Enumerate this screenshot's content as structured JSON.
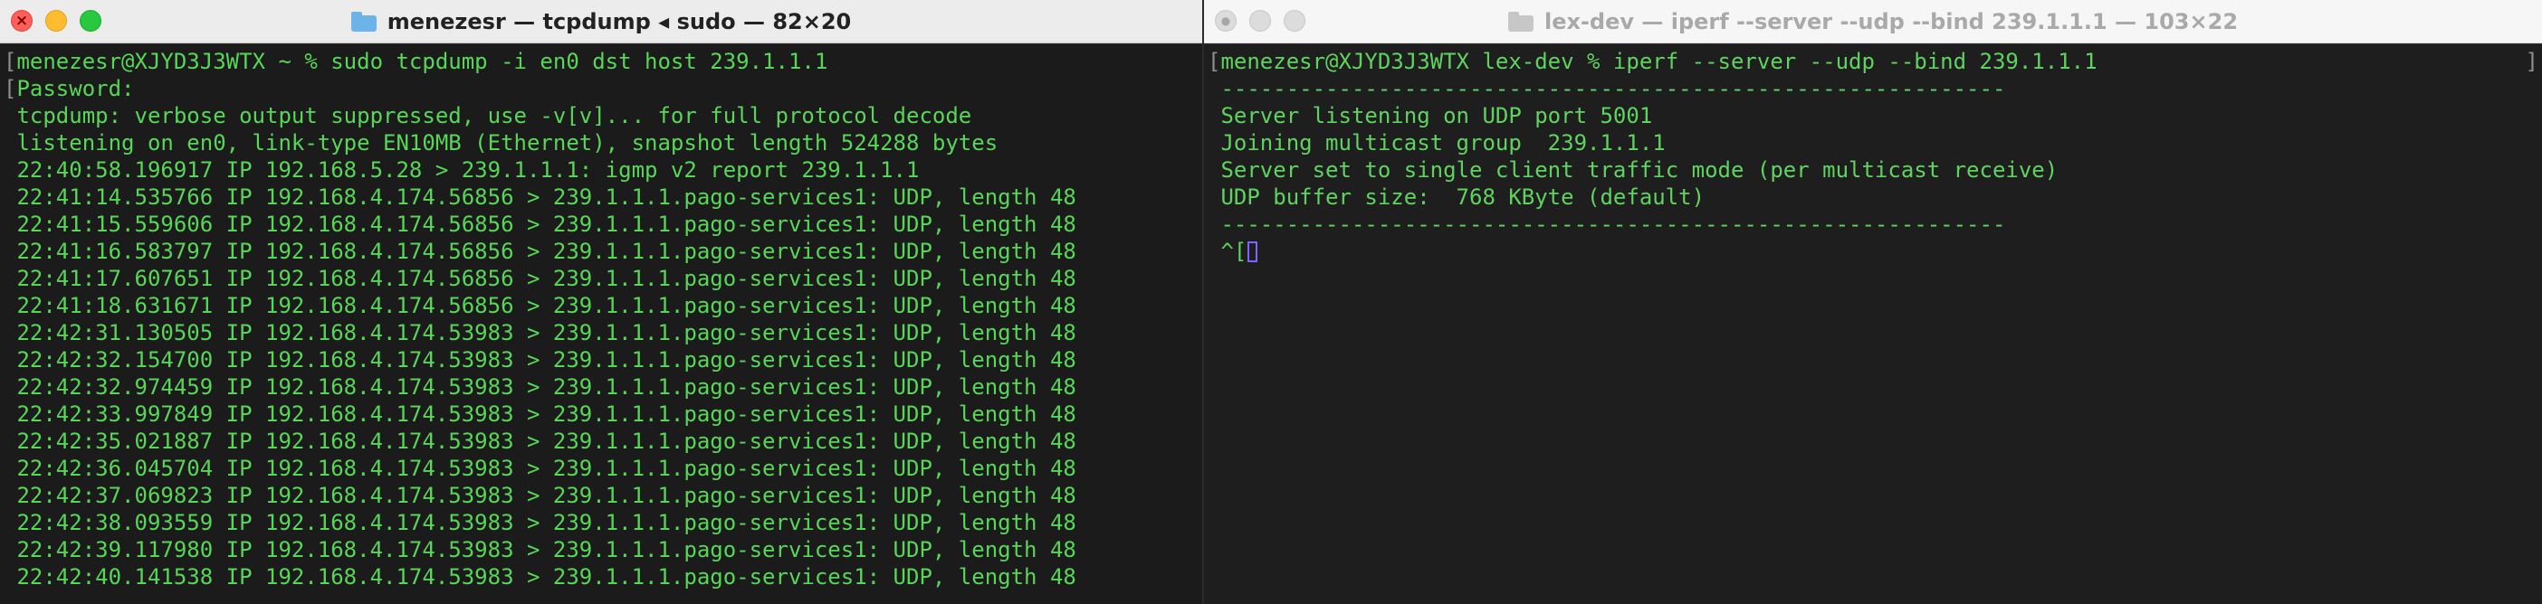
{
  "left_window": {
    "title": "menezesr — tcpdump ◂ sudo — 82×20",
    "lines": [
      "menezesr@XJYD3J3WTX ~ % sudo tcpdump -i en0 dst host 239.1.1.1",
      "Password:",
      "tcpdump: verbose output suppressed, use -v[v]... for full protocol decode",
      "listening on en0, link-type EN10MB (Ethernet), snapshot length 524288 bytes",
      "22:40:58.196917 IP 192.168.5.28 > 239.1.1.1: igmp v2 report 239.1.1.1",
      "22:41:14.535766 IP 192.168.4.174.56856 > 239.1.1.1.pago-services1: UDP, length 48",
      "22:41:15.559606 IP 192.168.4.174.56856 > 239.1.1.1.pago-services1: UDP, length 48",
      "22:41:16.583797 IP 192.168.4.174.56856 > 239.1.1.1.pago-services1: UDP, length 48",
      "22:41:17.607651 IP 192.168.4.174.56856 > 239.1.1.1.pago-services1: UDP, length 48",
      "22:41:18.631671 IP 192.168.4.174.56856 > 239.1.1.1.pago-services1: UDP, length 48",
      "22:42:31.130505 IP 192.168.4.174.53983 > 239.1.1.1.pago-services1: UDP, length 48",
      "22:42:32.154700 IP 192.168.4.174.53983 > 239.1.1.1.pago-services1: UDP, length 48",
      "22:42:32.974459 IP 192.168.4.174.53983 > 239.1.1.1.pago-services1: UDP, length 48",
      "22:42:33.997849 IP 192.168.4.174.53983 > 239.1.1.1.pago-services1: UDP, length 48",
      "22:42:35.021887 IP 192.168.4.174.53983 > 239.1.1.1.pago-services1: UDP, length 48",
      "22:42:36.045704 IP 192.168.4.174.53983 > 239.1.1.1.pago-services1: UDP, length 48",
      "22:42:37.069823 IP 192.168.4.174.53983 > 239.1.1.1.pago-services1: UDP, length 48",
      "22:42:38.093559 IP 192.168.4.174.53983 > 239.1.1.1.pago-services1: UDP, length 48",
      "22:42:39.117980 IP 192.168.4.174.53983 > 239.1.1.1.pago-services1: UDP, length 48",
      "22:42:40.141538 IP 192.168.4.174.53983 > 239.1.1.1.pago-services1: UDP, length 48"
    ]
  },
  "right_window": {
    "title": "lex-dev — iperf --server --udp --bind 239.1.1.1 — 103×22",
    "lines": [
      "menezesr@XJYD3J3WTX lex-dev % iperf --server --udp --bind 239.1.1.1",
      "------------------------------------------------------------",
      "Server listening on UDP port 5001",
      "Joining multicast group  239.1.1.1",
      "Server set to single client traffic mode (per multicast receive)",
      "UDP buffer size:  768 KByte (default)",
      "------------------------------------------------------------",
      "^["
    ]
  },
  "icons": {
    "close": "close-icon",
    "minimize": "minimize-icon",
    "zoom": "zoom-icon",
    "folder": "folder-icon"
  },
  "colors": {
    "terminal_text": "#57d657",
    "terminal_bg": "#1b1b1b",
    "cursor": "#7f62ff"
  }
}
